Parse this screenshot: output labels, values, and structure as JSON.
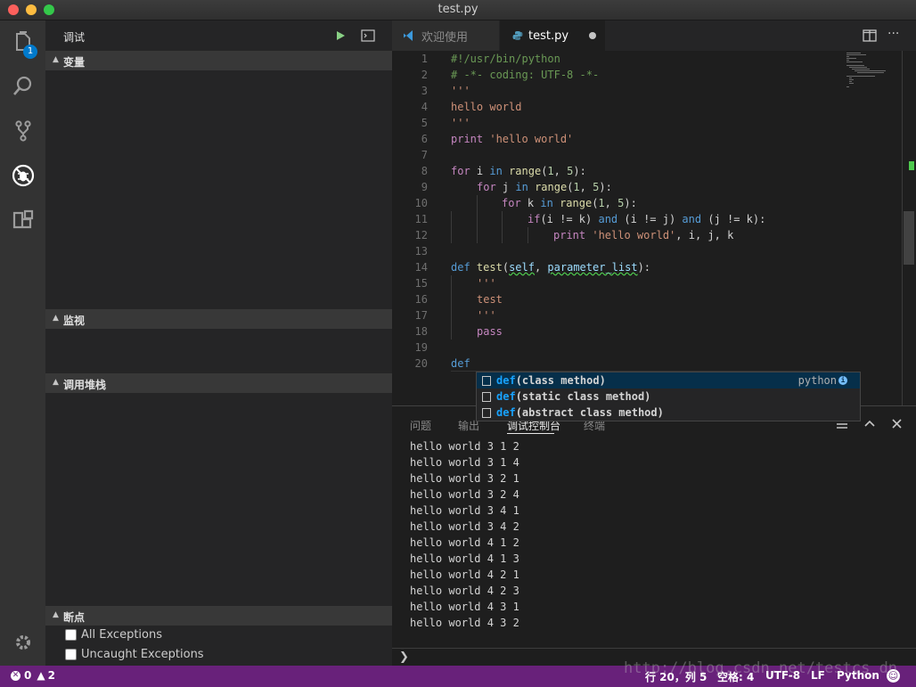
{
  "window": {
    "title": "test.py"
  },
  "activity": {
    "explorer_badge": "1"
  },
  "sidebar": {
    "title": "调试",
    "sections": {
      "variables": "变量",
      "watch": "监视",
      "callstack": "调用堆栈",
      "breakpoints": "断点"
    },
    "breakpoints": [
      "All Exceptions",
      "Uncaught Exceptions"
    ]
  },
  "tabs": {
    "welcome": "欢迎使用",
    "file": "test.py"
  },
  "editor": {
    "line_numbers": [
      "1",
      "2",
      "3",
      "4",
      "5",
      "6",
      "7",
      "8",
      "9",
      "10",
      "11",
      "12",
      "13",
      "14",
      "15",
      "16",
      "17",
      "18",
      "19",
      "20"
    ],
    "l1": "#!/usr/bin/python",
    "l2": "# -*- coding: UTF-8 -*-",
    "l3": "'''",
    "l4": "hello world",
    "l5": "'''",
    "l6_kw": "print",
    "l6_str": "'hello world'",
    "l8_a": "for",
    "l8_b": " i ",
    "l8_c": "in",
    "l8_d": "range",
    "l8_e": "(",
    "l8_f": "1",
    "l8_g": ", ",
    "l8_h": "5",
    "l8_i": "):",
    "l9_a": "for",
    "l9_b": " j ",
    "l9_c": "in",
    "l9_d": "range",
    "l9_e": "(",
    "l9_f": "1",
    "l9_g": ", ",
    "l9_h": "5",
    "l9_i": "):",
    "l10_a": "for",
    "l10_b": " k ",
    "l10_c": "in",
    "l10_d": "range",
    "l10_e": "(",
    "l10_f": "1",
    "l10_g": ", ",
    "l10_h": "5",
    "l10_i": "):",
    "l11_a": "if",
    "l11_b": "(i != k) ",
    "l11_c": "and",
    "l11_d": " (i != j) ",
    "l11_e": "and",
    "l11_f": " (j != k):",
    "l12_a": "print",
    "l12_b": " ",
    "l12_c": "'hello world'",
    "l12_d": ", i, j, k",
    "l14_a": "def",
    "l14_b": " ",
    "l14_c": "test",
    "l14_d": "(",
    "l14_e": "self",
    "l14_f": ", ",
    "l14_g": "parameter_list",
    "l14_h": "):",
    "l15": "'''",
    "l16": "test",
    "l17": "'''",
    "l18": "pass",
    "l20": "def"
  },
  "suggest": {
    "items": [
      {
        "kw": "def",
        "rest": "(class method)"
      },
      {
        "kw": "def",
        "rest": "(static class method)"
      },
      {
        "kw": "def",
        "rest": "(abstract class method)"
      }
    ],
    "detail": "python",
    "info_icon": "i"
  },
  "panel": {
    "tabs": [
      "问题",
      "输出",
      "调试控制台",
      "终端"
    ],
    "output": [
      "hello world 3 1 2",
      "hello world 3 1 4",
      "hello world 3 2 1",
      "hello world 3 2 4",
      "hello world 3 4 1",
      "hello world 3 4 2",
      "hello world 4 1 2",
      "hello world 4 1 3",
      "hello world 4 2 1",
      "hello world 4 2 3",
      "hello world 4 3 1",
      "hello world 4 3 2"
    ],
    "prompt": "❯"
  },
  "statusbar": {
    "errors": "0",
    "warnings": "2",
    "position": "行 20，列 5",
    "spaces": "空格: 4",
    "encoding": "UTF-8",
    "eol": "LF",
    "language": "Python"
  },
  "watermark": "http://blog.csdn.net/testcs_dn",
  "colors": {
    "statusbar": "#68217a",
    "accent": "#007acc"
  }
}
